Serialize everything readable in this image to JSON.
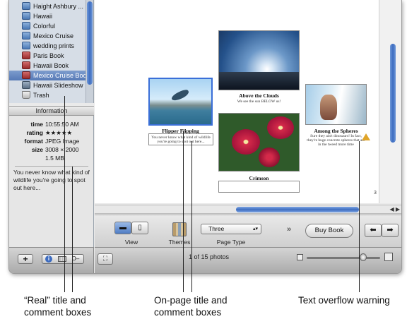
{
  "source_list": {
    "items": [
      {
        "label": "Haight Ashbury ...",
        "icon": "album-icon",
        "kind": "album",
        "selected": false
      },
      {
        "label": "Hawaii",
        "icon": "album-icon",
        "kind": "album",
        "selected": false
      },
      {
        "label": "Colorful",
        "icon": "album-icon",
        "kind": "album",
        "selected": false
      },
      {
        "label": "Mexico Cruise",
        "icon": "album-icon",
        "kind": "album",
        "selected": false
      },
      {
        "label": "wedding prints",
        "icon": "album-icon",
        "kind": "album",
        "selected": false
      },
      {
        "label": "Paris Book",
        "icon": "book-icon",
        "kind": "book",
        "selected": false
      },
      {
        "label": "Hawaii Book",
        "icon": "book-icon",
        "kind": "book",
        "selected": false
      },
      {
        "label": "Mexico Cruise Book",
        "icon": "book-icon",
        "kind": "book",
        "selected": true
      },
      {
        "label": "Hawaii Slideshow",
        "icon": "slideshow-icon",
        "kind": "show",
        "selected": false
      },
      {
        "label": "Trash",
        "icon": "trash-icon",
        "kind": "trash",
        "selected": false
      }
    ]
  },
  "info": {
    "header": "Information",
    "time_label": "time",
    "time_value": "10:55:50 AM",
    "rating_label": "rating",
    "rating_value": "★★★★★",
    "format_label": "format",
    "format_value": "JPEG Image",
    "size_label": "size",
    "size_value": "3008 × 2000",
    "filesize_value": "1.5 MB",
    "comment": "You never know what kind of wildlife you're going to spot out here..."
  },
  "page": {
    "left_photo": {
      "title": "Flipper Flipping",
      "comment": "You never know what kind of wildlife you're going to spot out here..."
    },
    "top_photo": {
      "title": "Above the Clouds",
      "comment": "We see the sun BELOW us!"
    },
    "middle_photo": {
      "title": "Crimson",
      "comment": ""
    },
    "right_photo": {
      "title": "Among the Spheres",
      "comment": "Sure they ain't dinosaurs! In fact, they're huge concrete spheres that are in the tweed more time"
    },
    "page_number": "3"
  },
  "toolbar": {
    "view_label": "View",
    "themes_label": "Themes",
    "page_type_label": "Page Type",
    "page_type_value": "Three",
    "buy_book_label": "Buy Book",
    "more_glyph": "»",
    "prev_glyph": "⬅",
    "next_glyph": "➡"
  },
  "bottom_bar": {
    "add_glyph": "+",
    "info_glyph": "i",
    "photo_count": "1 of 15 photos",
    "zoom_level": 0.77
  },
  "callouts": {
    "real_boxes": "“Real” title and comment boxes",
    "onpage_boxes": "On-page title and comment boxes",
    "overflow_warning": "Text overflow warning"
  },
  "colors": {
    "selection": "#5679b6",
    "scroll_thumb": "#3d6cc0",
    "warning": "#e0a52a"
  }
}
